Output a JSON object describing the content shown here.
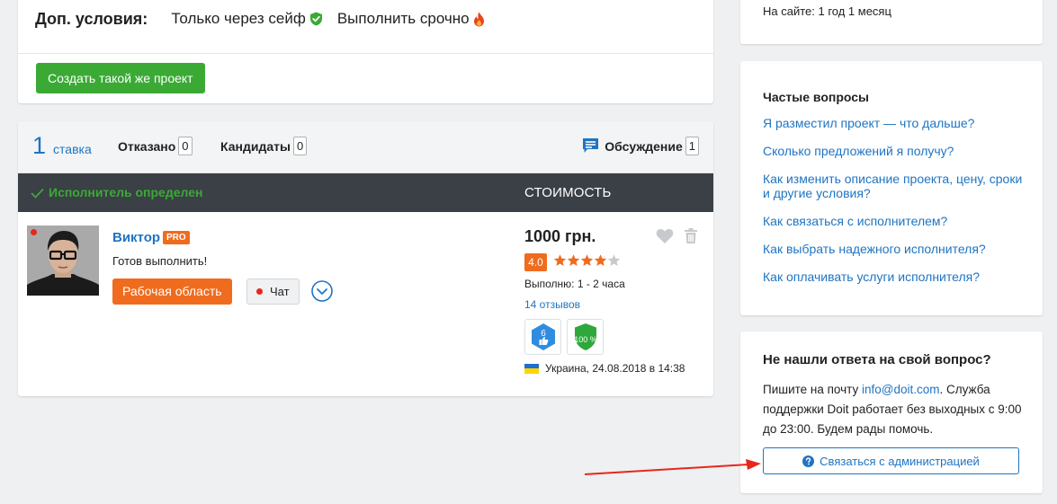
{
  "conditions": {
    "label": "Доп. условия:",
    "items": [
      {
        "text": "Только через сейф",
        "icon": "shield-check-icon"
      },
      {
        "text": "Выполнить срочно",
        "icon": "fire-icon"
      }
    ],
    "create_button": "Создать такой же проект"
  },
  "bids": {
    "tabs": {
      "bids_count": "1",
      "bids_label": "ставка",
      "refused_label": "Отказано",
      "refused_count": "0",
      "candidates_label": "Кандидаты",
      "candidates_count": "0",
      "discussion_label": "Обсуждение",
      "discussion_count": "1"
    },
    "header": {
      "status": "Исполнитель определен",
      "cost": "СТОИМОСТЬ"
    },
    "bid": {
      "name": "Виктор",
      "pro": "PRO",
      "text": "Готов выполнить!",
      "workspace_button": "Рабочая область",
      "chat_button": "Чат",
      "price": "1000 грн.",
      "rating": "4.0",
      "stars_filled": 4,
      "stars_total": 5,
      "duration": "Выполню: 1 - 2 часа",
      "reviews": "14 отзывов",
      "achievement_1": "6",
      "achievement_2": "100 %",
      "location": "Украина, 24.08.2018 в 14:38"
    }
  },
  "sidebar": {
    "on_site": "На сайте: 1 год 1 месяц",
    "faq": {
      "title": "Частые вопросы",
      "items": [
        "Я разместил проект — что дальше?",
        "Сколько предложений я получу?",
        "Как изменить описание проекта, цену, сроки и другие условия?",
        "Как связаться с исполнителем?",
        "Как выбрать надежного исполнителя?",
        "Как оплачивать услуги исполнителя?"
      ]
    },
    "support": {
      "title": "Не нашли ответа на свой вопрос?",
      "text_before": "Пишите на почту ",
      "email": "info@doit.com",
      "text_after": ". Служба поддержки Doit работает без выходных с 9:00 до 23:00. Будем рады помочь.",
      "contact_button": "Связаться с администрацией"
    }
  },
  "colors": {
    "brand_blue": "#1f74c3",
    "green": "#3aaa35",
    "orange": "#ef6c1e",
    "dark_header": "#3b3f46",
    "annotation_arrow": "#e8261b"
  }
}
